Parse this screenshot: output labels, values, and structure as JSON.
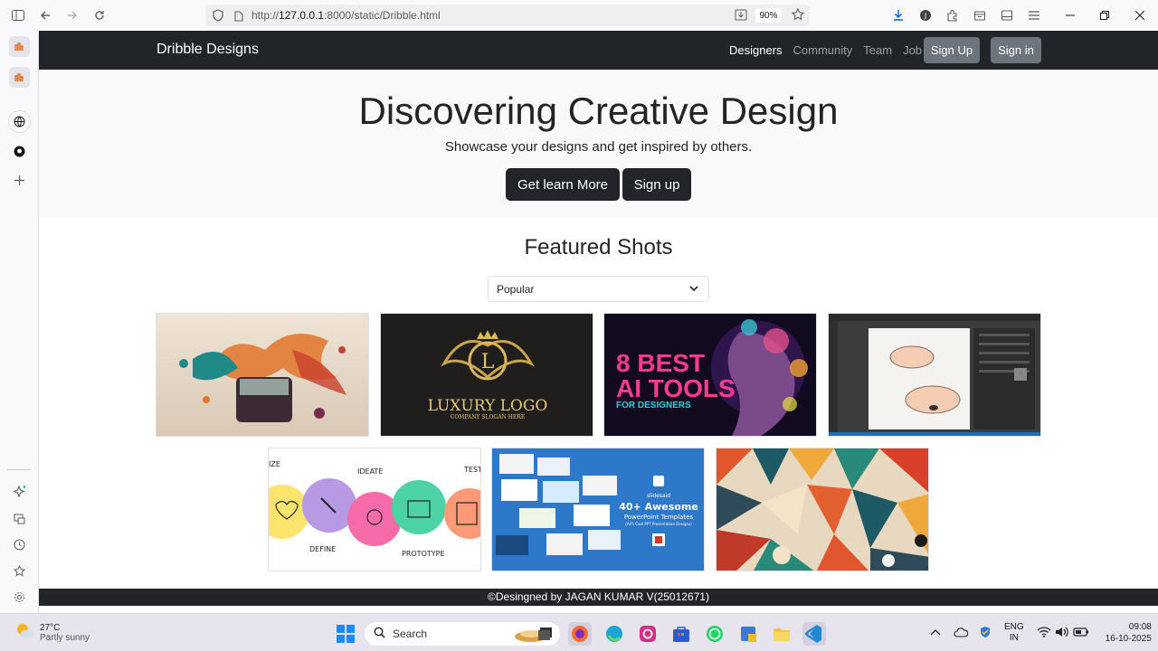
{
  "browser": {
    "url_prefix": "http://",
    "url_host": "127.0.0.1",
    "url_rest": ":8000/static/Dribble.html",
    "zoom": "90%"
  },
  "navbar": {
    "brand": "Dribble Designs",
    "links": [
      "Designers",
      "Community",
      "Team",
      "Job"
    ],
    "signup_label": "Sign Up",
    "signin_label": "Sign in"
  },
  "hero": {
    "title": "Discovering Creative Design",
    "lead": "Showcase your designs and get inspired by others.",
    "learn_label": "Get learn More",
    "signup_label": "Sign up"
  },
  "featured": {
    "title": "Featured Shots",
    "sort_value": "Popular",
    "shots": [
      {
        "text": ""
      },
      {
        "text": "LUXURY LOGO",
        "sub": "COMPANY SLOGAN HERE",
        "mono": "L"
      },
      {
        "text": "8 BEST",
        "text2": "AI TOOLS",
        "sub": "FOR DESIGNERS"
      },
      {
        "text": ""
      },
      {
        "labels": [
          "IZE",
          "IDEATE",
          "TEST",
          "DEFINE",
          "PROTOTYPE"
        ]
      },
      {
        "brand": "slidesaid",
        "text": "40+ Awesome",
        "text2": "PowerPoint Templates",
        "sub": "(All's Cool PPT Presentation Designs)"
      },
      {
        "text": ""
      }
    ]
  },
  "footer": {
    "text": "©Desingned by JAGAN KUMAR V(25012671)"
  },
  "taskbar": {
    "temp": "27°C",
    "weather": "Partly sunny",
    "search_placeholder": "Search",
    "lang1": "ENG",
    "lang2": "IN",
    "time": "09:08",
    "date": "16-10-2025"
  }
}
